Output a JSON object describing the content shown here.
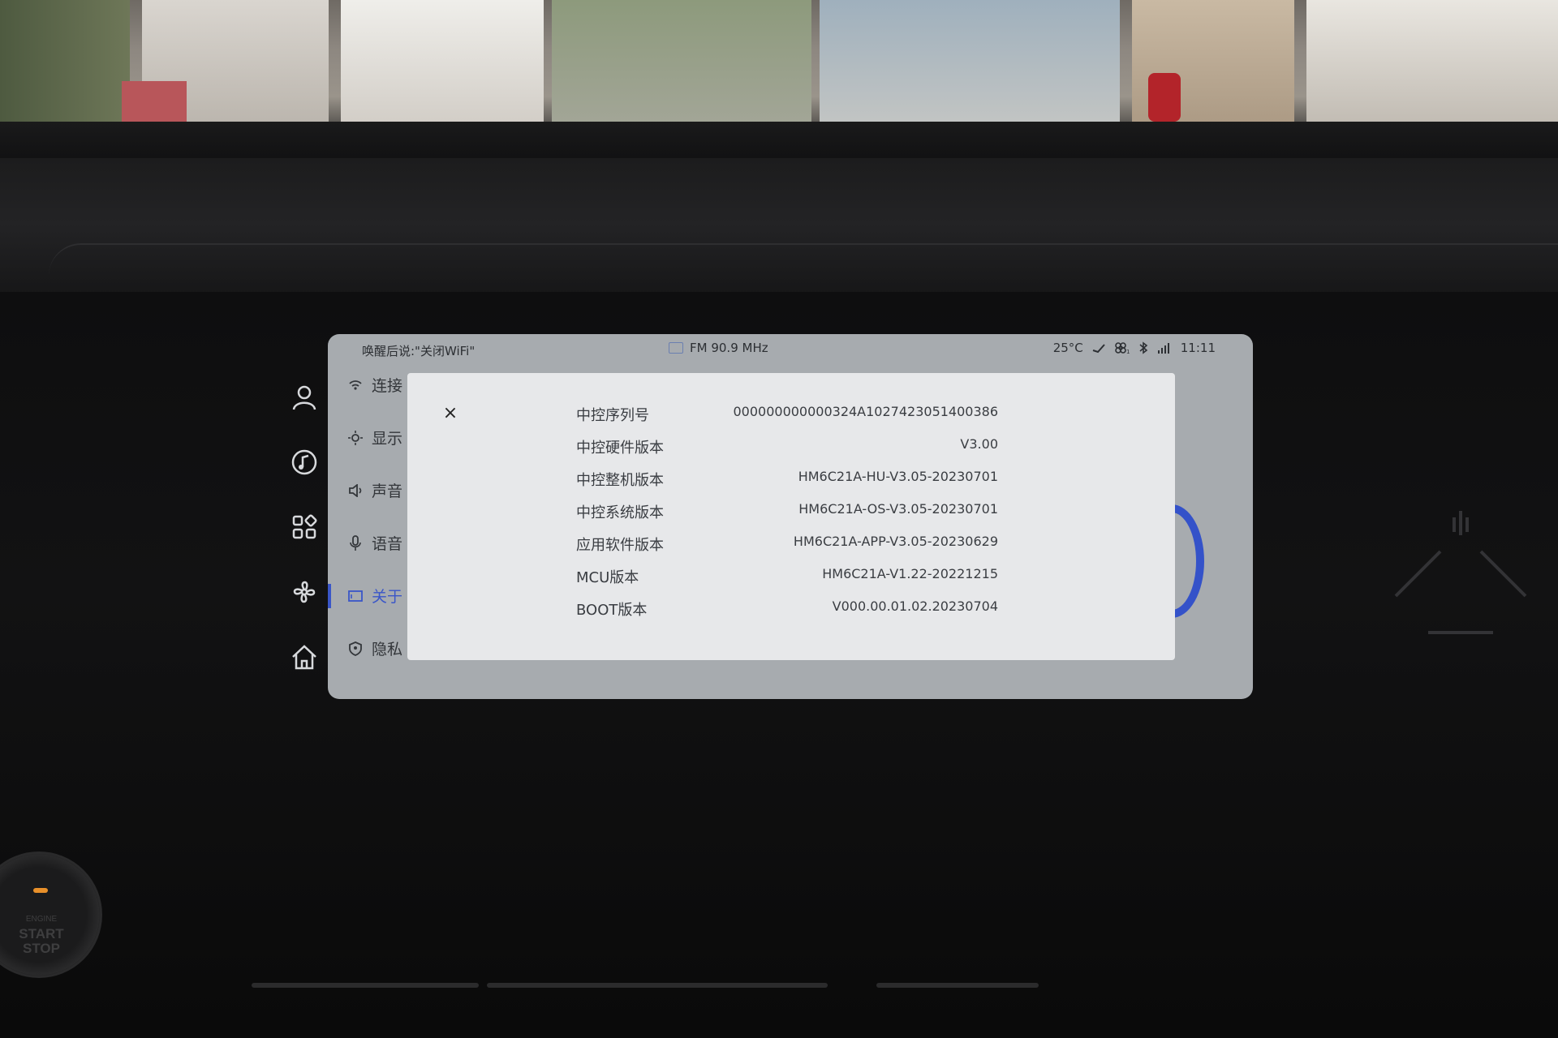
{
  "status_bar": {
    "wake_hint": "唤醒后说:\"关闭WiFi\"",
    "radio": "FM 90.9 MHz",
    "temperature": "25°C",
    "time": "11:11",
    "icons": [
      "cloud-icon",
      "fan-icon",
      "bluetooth-icon",
      "signal-icon"
    ]
  },
  "dock": {
    "icons": [
      "user-icon",
      "music-icon",
      "apps-icon",
      "fan-icon",
      "home-icon"
    ]
  },
  "settings": {
    "items": [
      {
        "label": "连接",
        "icon": "wifi-icon"
      },
      {
        "label": "显示",
        "icon": "brightness-icon"
      },
      {
        "label": "声音",
        "icon": "speaker-icon"
      },
      {
        "label": "语音",
        "icon": "microphone-icon"
      },
      {
        "label": "关于",
        "icon": "info-card-icon",
        "active": true
      },
      {
        "label": "隐私",
        "icon": "shield-icon"
      }
    ]
  },
  "about_dialog": {
    "close_label": "×",
    "rows": [
      {
        "key": "中控序列号",
        "value": "000000000000324A1027423051400386"
      },
      {
        "key": "中控硬件版本",
        "value": "V3.00"
      },
      {
        "key": "中控整机版本",
        "value": "HM6C21A-HU-V3.05-20230701"
      },
      {
        "key": "中控系统版本",
        "value": "HM6C21A-OS-V3.05-20230701"
      },
      {
        "key": "应用软件版本",
        "value": "HM6C21A-APP-V3.05-20230629"
      },
      {
        "key": "MCU版本",
        "value": "HM6C21A-V1.22-20221215"
      },
      {
        "key": "BOOT版本",
        "value": "V000.00.01.02.20230704"
      }
    ]
  },
  "engine_button": {
    "small": "ENGINE",
    "line1": "START",
    "line2": "STOP"
  },
  "colors": {
    "screen_bg": "#a7abaf",
    "dialog_bg": "#e7e8ea",
    "accent": "#3a56c8",
    "start_led": "#e8902a"
  }
}
